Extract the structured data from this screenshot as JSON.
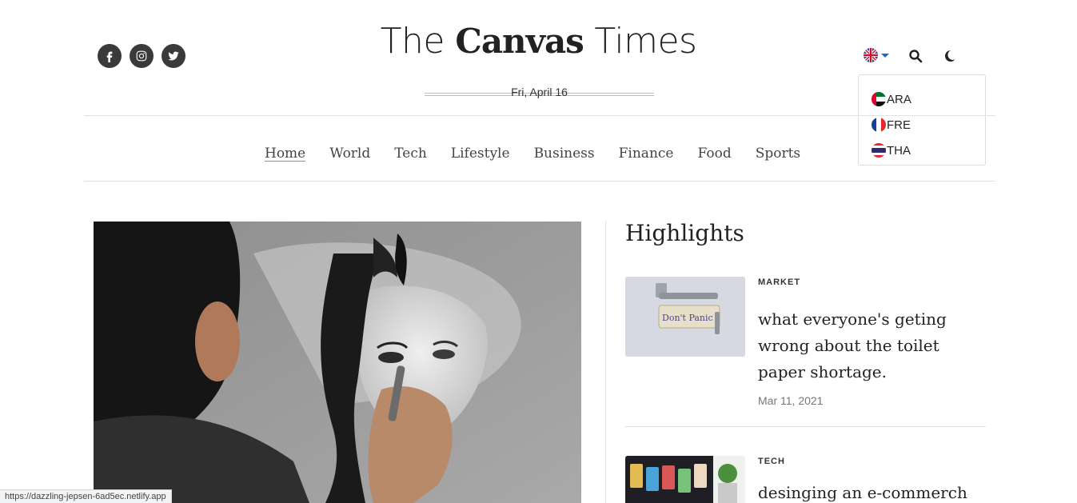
{
  "brand": {
    "part1": "The ",
    "part2": "Canvas",
    "part3": " Times"
  },
  "date": "Fri, April 16",
  "social": [
    "facebook-icon",
    "instagram-icon",
    "twitter-icon"
  ],
  "language": {
    "current": "uk-flag-icon",
    "options": [
      {
        "code": "ARA",
        "flag": "uae-flag-icon"
      },
      {
        "code": "FRE",
        "flag": "france-flag-icon"
      },
      {
        "code": "THA",
        "flag": "thailand-flag-icon"
      }
    ]
  },
  "nav": [
    "Home",
    "World",
    "Tech",
    "Lifestyle",
    "Business",
    "Finance",
    "Food",
    "Sports"
  ],
  "highlights": {
    "title": "Highlights",
    "items": [
      {
        "category": "MARKET",
        "headline": "what everyone's geting wrong about the toilet paper shortage.",
        "date": "Mar 11, 2021"
      },
      {
        "category": "TECH",
        "headline": "desinging an e-commerch"
      }
    ]
  },
  "toilet_roll_text": "Don't Panic",
  "status_url": "https://dazzling-jepsen-6ad5ec.netlify.app",
  "colors": {
    "accent_underline": "#e06c6c",
    "caret": "#1f66c7",
    "icon_bg": "#3a3a3a"
  }
}
